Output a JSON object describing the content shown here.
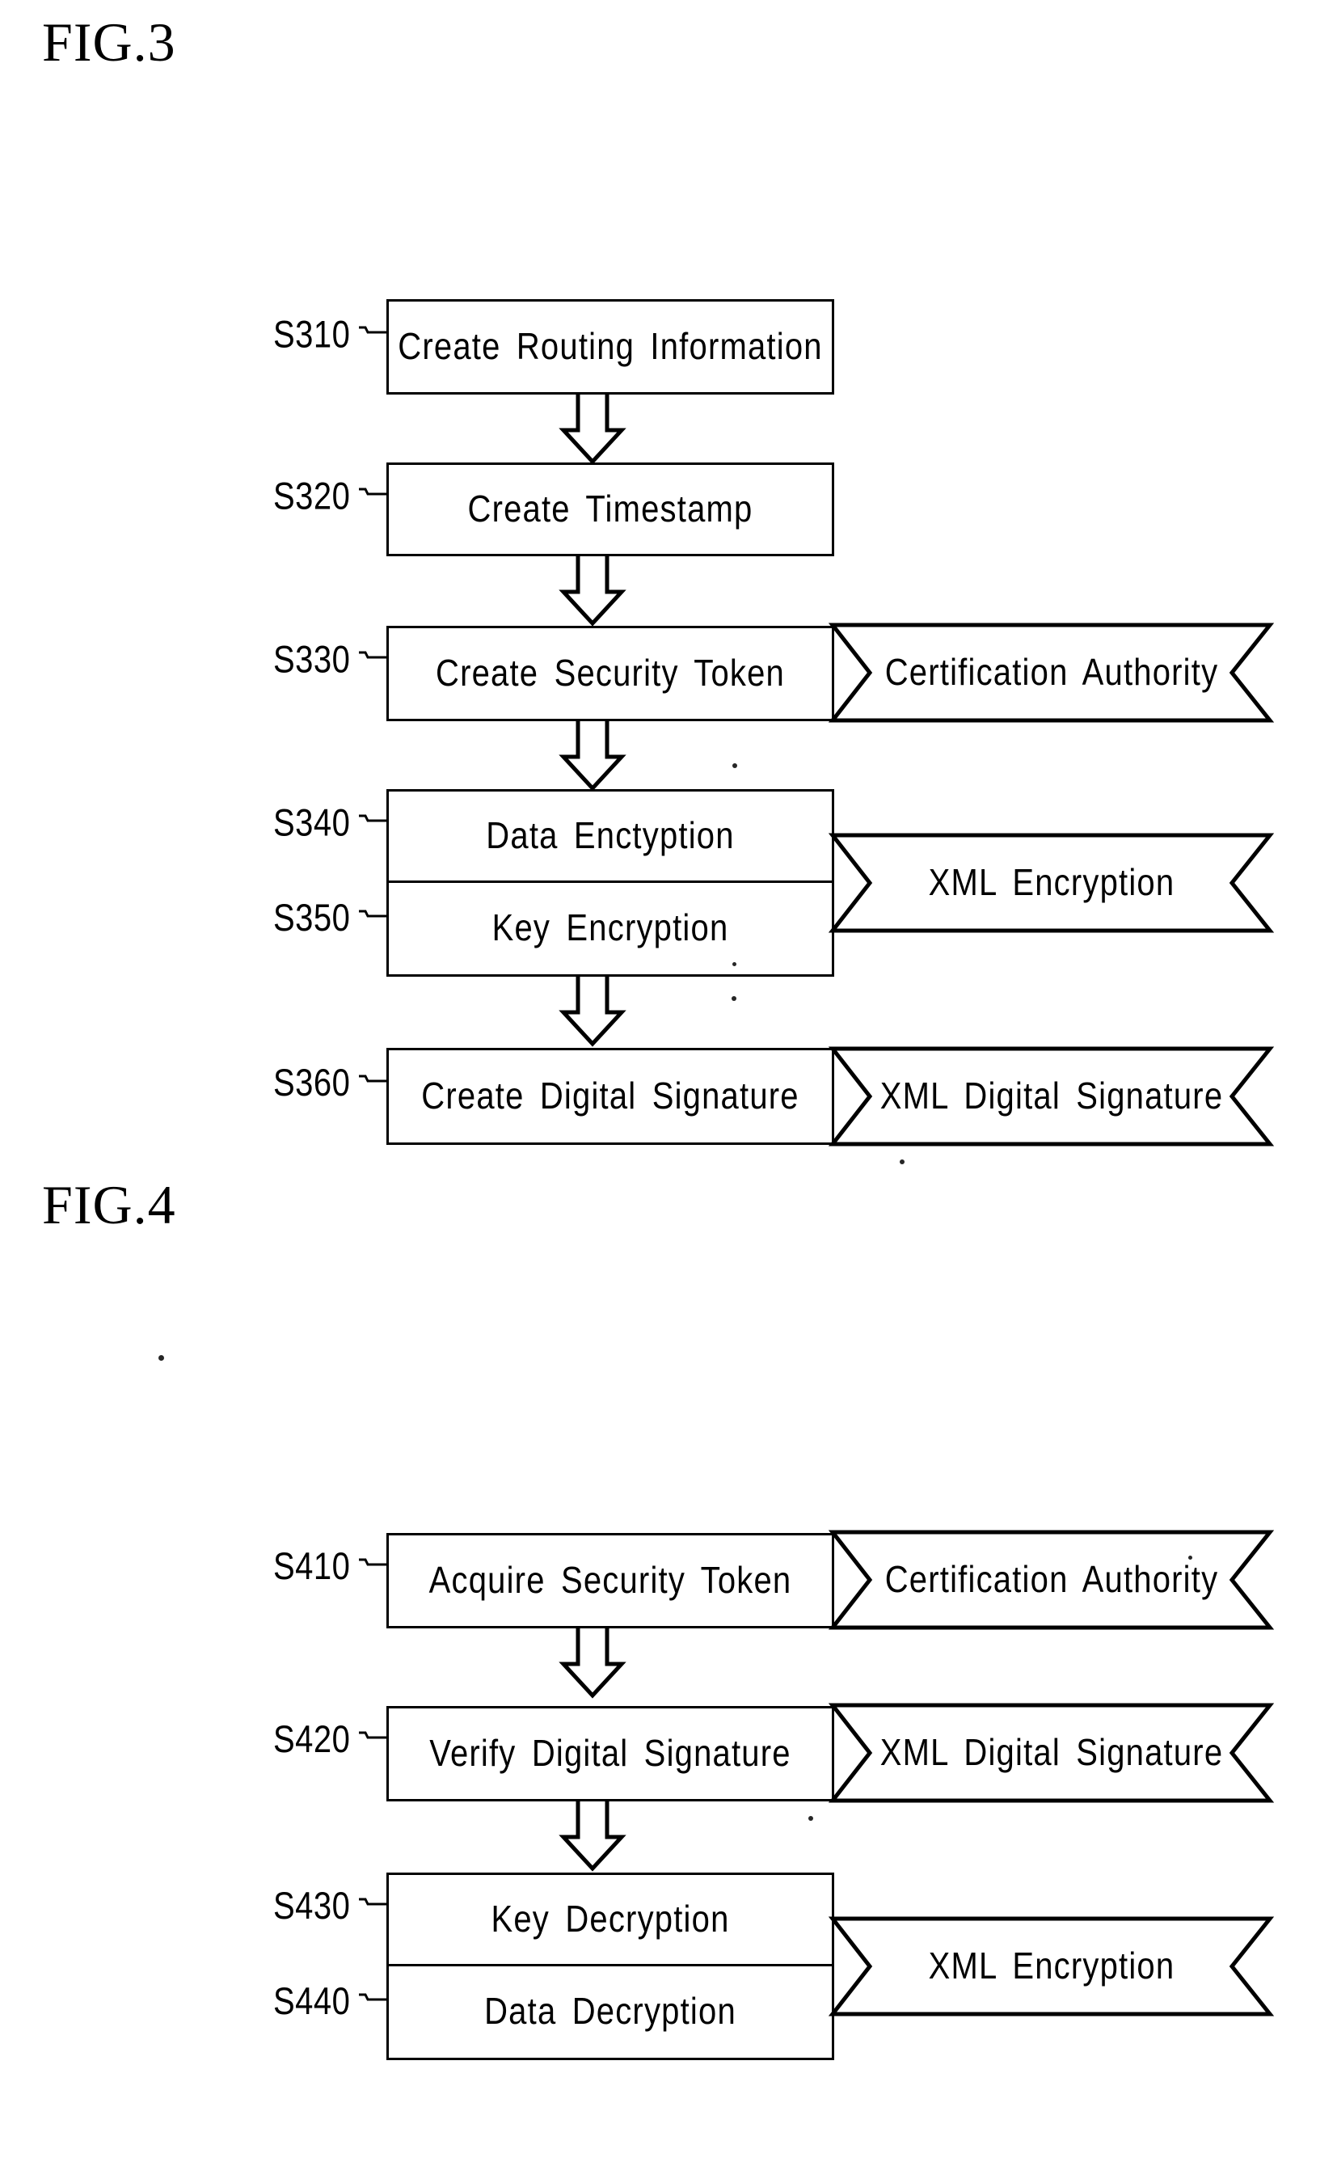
{
  "document": {
    "kind": "patent-figure-sheet",
    "background_color": "#ffffff",
    "ink_color": "#000000"
  },
  "figures": [
    {
      "id": "fig-3",
      "title": "FIG.3",
      "steps": [
        {
          "id": "S310",
          "label": "Create  Routing  Information"
        },
        {
          "id": "S320",
          "label": "Create  Timestamp"
        },
        {
          "id": "S330",
          "label": "Create  Security Token"
        },
        {
          "id": "S340",
          "label": "Data  Enctyption"
        },
        {
          "id": "S350",
          "label": "Key  Encryption"
        },
        {
          "id": "S360",
          "label": "Create  Digital  Signature"
        }
      ],
      "banners": [
        {
          "id": "fig3-banner-ca",
          "label": "Certification  Authority",
          "attached_to": "S330"
        },
        {
          "id": "fig3-banner-enc",
          "label": "XML Encryption",
          "attached_to": "S340/S350"
        },
        {
          "id": "fig3-banner-sig",
          "label": "XML Digital  Signature",
          "attached_to": "S360"
        }
      ],
      "arrows": [
        {
          "from": "S310",
          "to": "S320",
          "direction": "down"
        },
        {
          "from": "S320",
          "to": "S330",
          "direction": "down"
        },
        {
          "from": "S330",
          "to": "S340",
          "direction": "down"
        },
        {
          "from": "S350",
          "to": "S360",
          "direction": "down"
        }
      ]
    },
    {
      "id": "fig-4",
      "title": "FIG.4",
      "steps": [
        {
          "id": "S410",
          "label": "Acquire  Security Token"
        },
        {
          "id": "S420",
          "label": "Verify  Digital  Signature"
        },
        {
          "id": "S430",
          "label": "Key  Decryption"
        },
        {
          "id": "S440",
          "label": "Data  Decryption"
        }
      ],
      "banners": [
        {
          "id": "fig4-banner-ca",
          "label": "Certification  Authority",
          "attached_to": "S410"
        },
        {
          "id": "fig4-banner-sig",
          "label": "XML Digital  Signature",
          "attached_to": "S420"
        },
        {
          "id": "fig4-banner-enc",
          "label": "XML Encryption",
          "attached_to": "S430/S440"
        }
      ],
      "arrows": [
        {
          "from": "S410",
          "to": "S420",
          "direction": "down"
        },
        {
          "from": "S420",
          "to": "S430",
          "direction": "down"
        }
      ]
    }
  ]
}
